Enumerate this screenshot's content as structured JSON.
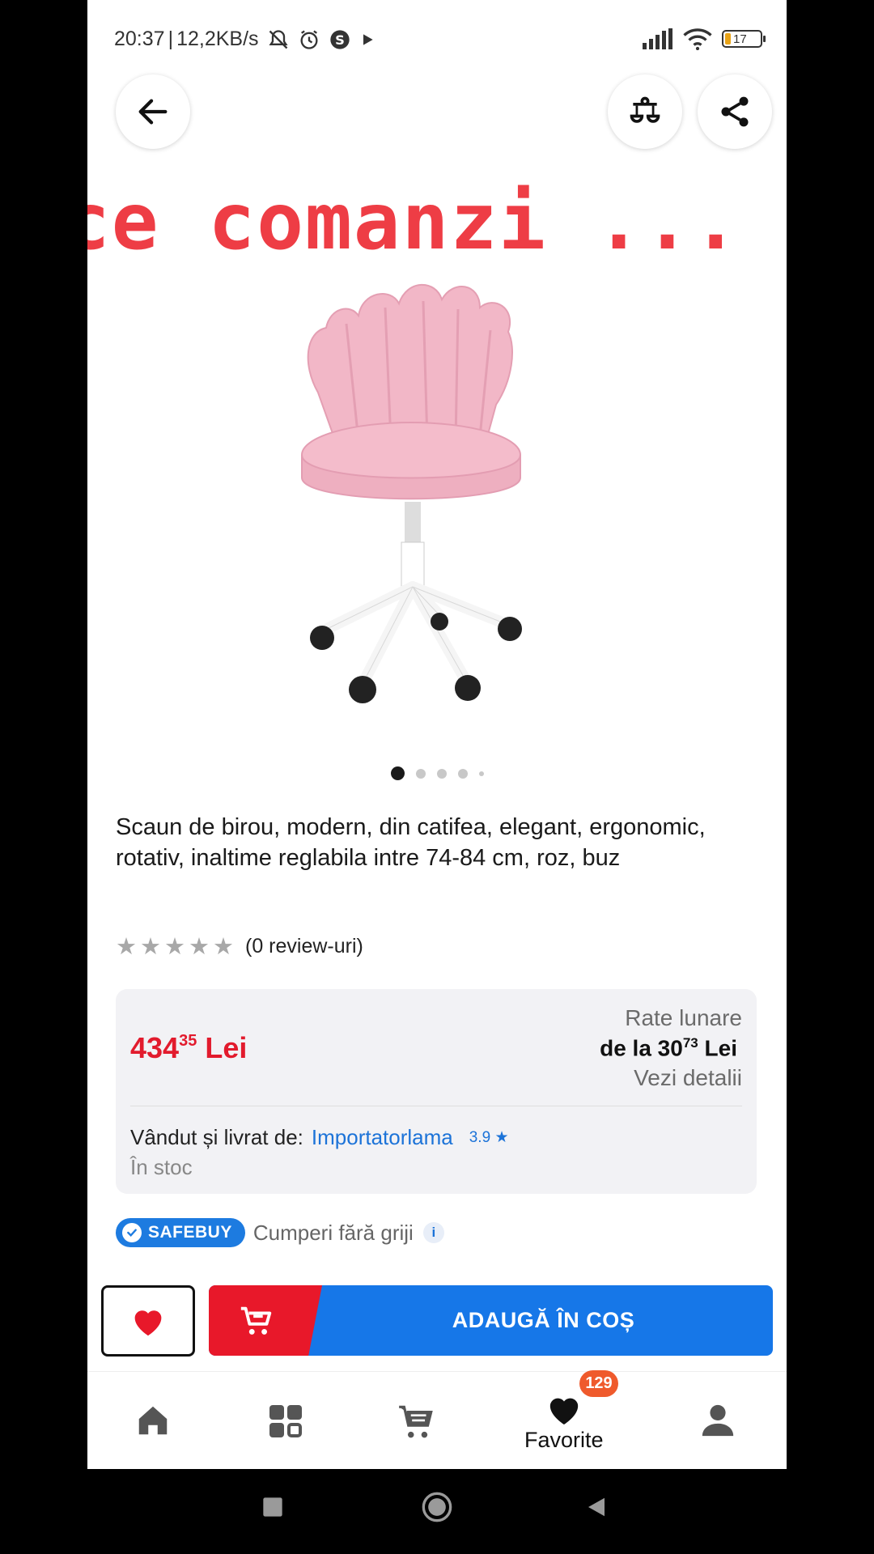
{
  "status_bar": {
    "time": "20:37",
    "separator": "|",
    "network_speed": "12,2KB/s",
    "battery": "17"
  },
  "overlay_caption": "ce comanzi ...",
  "product": {
    "image_dots": 5,
    "title": "Scaun de birou, modern, din catifea, elegant, ergonomic, rotativ, inaltime reglabila intre 74-84 cm, roz, buz",
    "rating_text": "(0 review-uri)",
    "stars_filled": 0
  },
  "price_box": {
    "price_int": "434",
    "price_dec": "35",
    "price_currency": "Lei",
    "installments_label": "Rate lunare",
    "installments_prefix": "de la 30",
    "installments_dec": "73",
    "installments_currency": "Lei",
    "details_link": "Vezi detalii",
    "seller_label": "Vândut și livrat de:",
    "seller_name": "Importatorlama",
    "seller_score": "3.9",
    "stock": "În stoc"
  },
  "safebuy": {
    "badge": "SAFEBUY",
    "text": "Cumperi fără griji",
    "info": "i"
  },
  "actions": {
    "add_to_cart": "ADAUGĂ ÎN COȘ"
  },
  "bottom_nav": {
    "favorites_label": "Favorite",
    "favorites_count": "129"
  },
  "colors": {
    "accent_red": "#e21b2d",
    "accent_blue": "#1677e8",
    "badge_orange": "#ef5a2c"
  }
}
